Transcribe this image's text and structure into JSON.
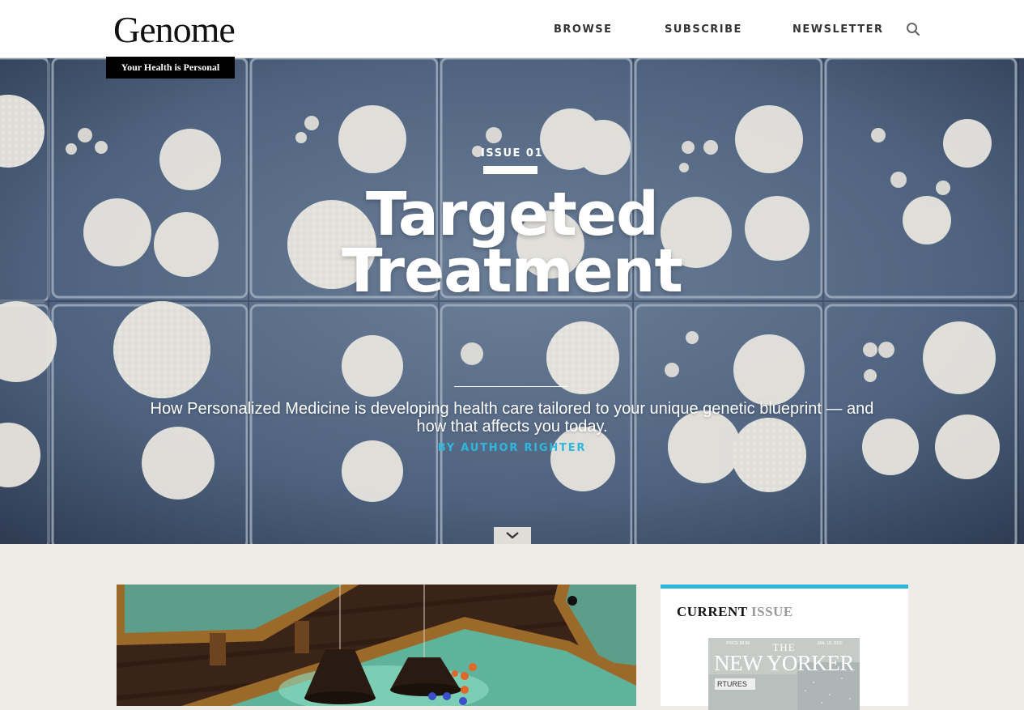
{
  "brand": {
    "logo": "Genome",
    "tagline": "Your Health is Personal"
  },
  "nav": {
    "browse": "BROWSE",
    "subscribe": "SUBSCRIBE",
    "newsletter": "NEWSLETTER",
    "search_icon": "search-icon"
  },
  "hero": {
    "issue": "ISSUE 01",
    "title_line1": "Targeted",
    "title_line2": "Treatment",
    "subtitle": "How Personalized Medicine is developing health care tailored to your unique genetic blueprint — and how that affects you today.",
    "byline": "BY AUTHOR RIGHTER",
    "scroll_icon": "chevron-down-icon"
  },
  "sidebar": {
    "current_label_a": "CURRENT",
    "current_label_b": "ISSUE",
    "cover": {
      "the": "THE",
      "name": "NEW YORKER",
      "price": "PRICE $8.99",
      "date": "JAN. 18, 2016",
      "sign": "RTURES"
    }
  },
  "colors": {
    "accent": "#2fb7dc",
    "header_bg": "#ffffff",
    "page_bg": "#efece7",
    "hero_bg": "#4b5f7a"
  }
}
